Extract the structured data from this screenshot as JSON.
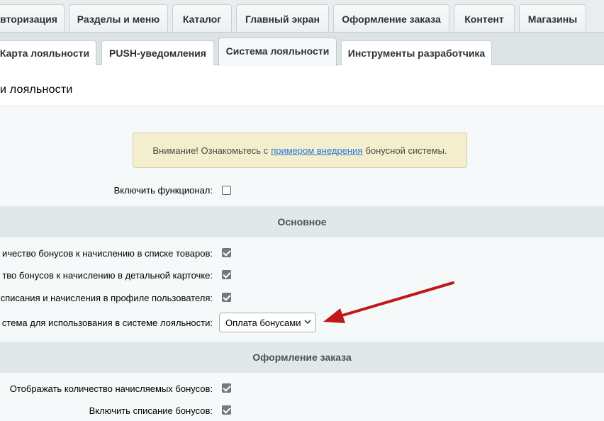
{
  "top_tabs": [
    {
      "label": "вторизация",
      "active": false
    },
    {
      "label": "Разделы и меню",
      "active": false
    },
    {
      "label": "Каталог",
      "active": false
    },
    {
      "label": "Главный экран",
      "active": false
    },
    {
      "label": "Оформление заказа",
      "active": false
    },
    {
      "label": "Контент",
      "active": false
    },
    {
      "label": "Магазины",
      "active": false
    }
  ],
  "sub_tabs": [
    {
      "label": "Карта лояльности",
      "active": false
    },
    {
      "label": "PUSH-уведомления",
      "active": false
    },
    {
      "label": "Система лояльности",
      "active": true
    },
    {
      "label": "Инструменты разработчика",
      "active": false
    }
  ],
  "page_title": "и лояльности",
  "notice": {
    "before": "Внимание! Ознакомьтесь с",
    "link": "примером внедрения",
    "after": "бонусной системы."
  },
  "enable": {
    "label": "Включить функционал:",
    "checked": false
  },
  "sections": {
    "main": "Основное",
    "order": "Оформление заказа"
  },
  "main_fields": [
    {
      "label": "ичество бонусов к начислению в списке товаров:",
      "checked": true
    },
    {
      "label": "тво бонусов к начислению в детальной карточке:",
      "checked": true
    },
    {
      "label": "списания и начисления в профиле пользователя:",
      "checked": true
    }
  ],
  "payment_system": {
    "label": "стема для использования в системе лояльности:",
    "selected": "Оплата бонусами"
  },
  "order_fields": [
    {
      "label": "Отображать количество начисляемых бонусов:",
      "checked": true
    },
    {
      "label": "Включить списание бонусов:",
      "checked": true
    }
  ],
  "colors": {
    "annotation_arrow": "#c0171b",
    "notice_bg": "#f3efce",
    "link": "#2675d7"
  }
}
